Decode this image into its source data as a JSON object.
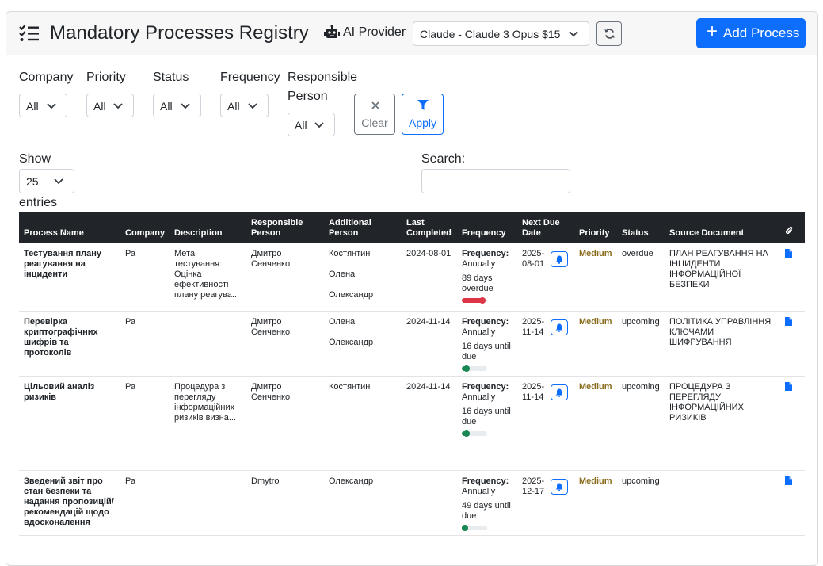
{
  "header": {
    "title": "Mandatory Processes Registry",
    "ai_provider_label": "AI Provider",
    "ai_provider_value": "Claude - Claude 3 Opus $15",
    "add_button_label": "Add Process"
  },
  "filters": {
    "company": {
      "label": "Company",
      "value": "All"
    },
    "priority": {
      "label": "Priority",
      "value": "All"
    },
    "status": {
      "label": "Status",
      "value": "All"
    },
    "frequency": {
      "label": "Frequency",
      "value": "All"
    },
    "responsible": {
      "label_line1": "Responsible",
      "label_line2": "Person",
      "value": "All"
    },
    "clear_label": "Clear",
    "apply_label": "Apply"
  },
  "table_controls": {
    "show_label": "Show",
    "page_size": "25",
    "entries_label": "entries",
    "search_label": "Search:",
    "search_value": ""
  },
  "table": {
    "headers": [
      "Process Name",
      "Company",
      "Description",
      "Responsible Person",
      "Additional Person",
      "Last Completed",
      "Frequency",
      "Next Due Date",
      "Priority",
      "Status",
      "Source Document",
      ""
    ],
    "rows": [
      {
        "name": "Тестування плану реагування на інциденти",
        "company": "Ра",
        "description": "Мета тестування: Оцінка ефективності плану реагува...",
        "responsible": "Дмитро Сенченко",
        "additional": [
          "Костянтин",
          "Олена",
          "Олександр"
        ],
        "last_completed": "2024-08-01",
        "frequency_label": "Frequency:",
        "frequency_value": "Annually",
        "due_note": "89 days overdue",
        "progress": 0.94,
        "progress_color": "#dc3545",
        "next_due": "2025-08-01",
        "priority": "Medium",
        "status": "overdue",
        "source": "ПЛАН РЕАГУВАННЯ НА ІНЦИДЕНТИ ІНФОРМАЦІЙНОЇ БЕЗПЕКИ"
      },
      {
        "name": "Перевірка криптографічних шифрів та протоколів",
        "company": "Ра",
        "description": "",
        "responsible": "Дмитро Сенченко",
        "additional": [
          "Олена",
          "Олександр"
        ],
        "last_completed": "2024-11-14",
        "frequency_label": "Frequency:",
        "frequency_value": "Annually",
        "due_note": "16 days until due",
        "progress": 0.3,
        "progress_color": "#198754",
        "next_due": "2025-11-14",
        "priority": "Medium",
        "status": "upcoming",
        "source": "ПОЛІТИКА УПРАВЛІННЯ КЛЮЧАМИ ШИФРУВАННЯ"
      },
      {
        "name": "Цільовий аналіз ризиків",
        "company": "Ра",
        "description": "Процедура з перегляду інформаційних ризиків визна...",
        "responsible": "Дмитро Сенченко",
        "additional": [
          "Костянтин"
        ],
        "last_completed": "2024-11-14",
        "frequency_label": "Frequency:",
        "frequency_value": "Annually",
        "due_note": "16 days until due",
        "progress": 0.3,
        "progress_color": "#198754",
        "next_due": "2025-11-14",
        "priority": "Medium",
        "status": "upcoming",
        "source": "ПРОЦЕДУРА З ПЕРЕГЛЯДУ ІНФОРМАЦІЙНИХ РИЗИКІВ"
      },
      {
        "name": "Зведений звіт про стан безпеки та надання пропозицій/рекомендацій щодо вдосконалення",
        "company": "Ра",
        "description": "",
        "responsible": "Dmytro",
        "additional": [
          "Олександр"
        ],
        "last_completed": "",
        "frequency_label": "Frequency:",
        "frequency_value": "Annually",
        "due_note": "49 days until due",
        "progress": 0.2,
        "progress_color": "#198754",
        "next_due": "2025-12-17",
        "priority": "Medium",
        "status": "upcoming",
        "source": ""
      }
    ]
  },
  "colors": {
    "primary": "#0d6efd",
    "header_dark": "#212529",
    "priority_medium": "#8a6d1d",
    "danger": "#dc3545",
    "success": "#198754"
  },
  "icons": [
    "list-check-icon",
    "robot-icon",
    "chevron-down-icon",
    "refresh-icon",
    "plus-icon",
    "close-icon",
    "filter-icon",
    "bell-icon",
    "file-icon",
    "paperclip-icon"
  ]
}
